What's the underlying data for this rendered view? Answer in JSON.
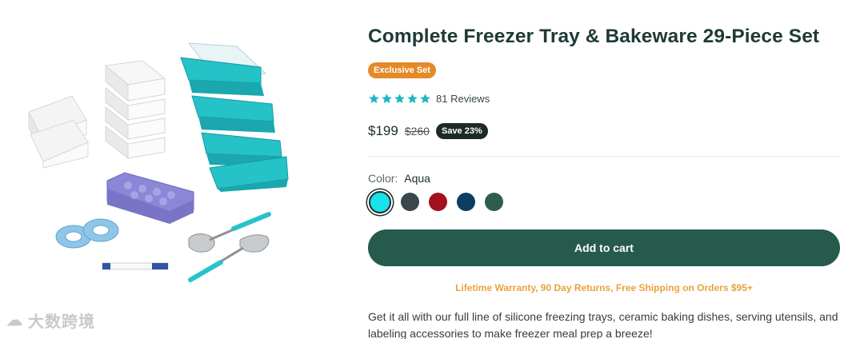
{
  "product": {
    "title": "Complete Freezer Tray & Bakeware 29-Piece Set",
    "badge": "Exclusive Set",
    "rating": {
      "stars": 5,
      "reviews_label": "81 Reviews"
    },
    "price": "$199",
    "compare_price": "$260",
    "save_label": "Save 23%",
    "color_label": "Color:",
    "color_value": "Aqua",
    "swatches": [
      {
        "name": "Aqua",
        "color": "#19e3ea",
        "selected": true
      },
      {
        "name": "Charcoal",
        "color": "#3b474d",
        "selected": false
      },
      {
        "name": "Red",
        "color": "#a3111c",
        "selected": false
      },
      {
        "name": "Navy",
        "color": "#0c3d63",
        "selected": false
      },
      {
        "name": "Green",
        "color": "#2e5e4b",
        "selected": false
      }
    ],
    "add_to_cart": "Add to cart",
    "warranty": "Lifetime Warranty, 90 Day Returns, Free Shipping on Orders $95+",
    "description": "Get it all with our full line of silicone freezing trays, ceramic baking dishes, serving utensils, and labeling accessories to make freezer meal prep a breeze!"
  },
  "watermark": "大数跨境",
  "colors": {
    "accent_green": "#265a4c",
    "badge_orange": "#e48a27",
    "star_teal": "#1ab8c4",
    "warranty_orange": "#eaa23c"
  }
}
